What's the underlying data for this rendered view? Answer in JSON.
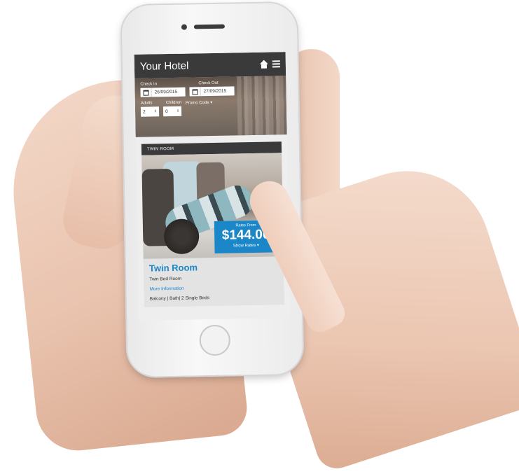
{
  "app": {
    "title": "Your Hotel"
  },
  "header": {
    "home_icon": "home-icon",
    "menu_icon": "hamburger-menu-icon"
  },
  "booking": {
    "check_in_label": "Check In",
    "check_in_value": "26/09/2015",
    "check_out_label": "Check Out",
    "check_out_value": "27/09/2015",
    "adults_label": "Adults",
    "adults_value": "2",
    "children_label": "Children",
    "children_value": "0",
    "promo_label": "Promo Code ▾"
  },
  "room": {
    "header": "TWIN ROOM",
    "rates_from_label": "Rates From",
    "price": "$144.00",
    "show_rates_label": "Show Rates ▾",
    "name": "Twin Room",
    "type": "Twin Bed Room",
    "more_info_label": "More Information",
    "amenities": "Balcony | Bath| 2 Single Beds"
  },
  "colors": {
    "accent": "#1b86c8",
    "header_bg": "#3a3a3a"
  }
}
